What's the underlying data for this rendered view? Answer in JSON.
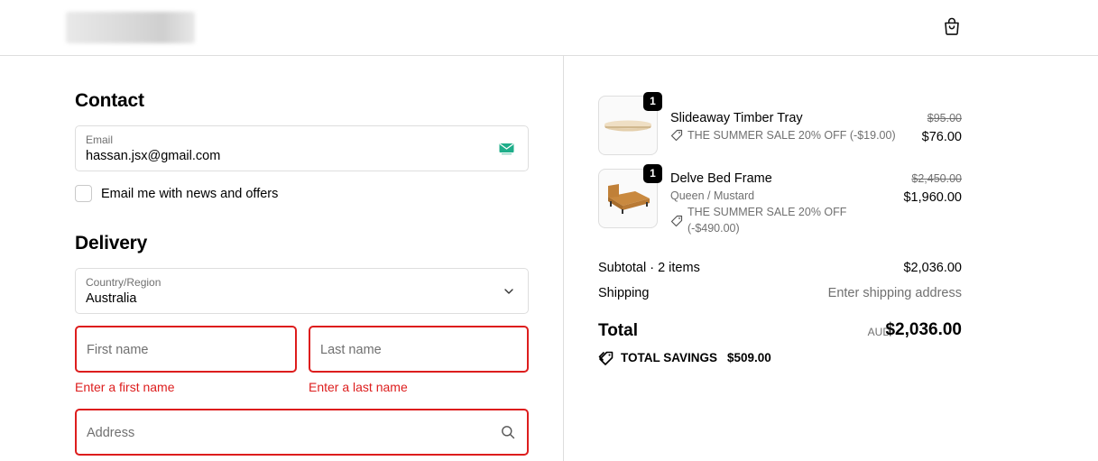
{
  "header": {
    "cart_icon": "shopping-bag-icon"
  },
  "contact": {
    "title": "Contact",
    "email_label": "Email",
    "email_value": "hassan.jsx@gmail.com",
    "newsletter_label": "Email me with news and offers"
  },
  "delivery": {
    "title": "Delivery",
    "country_label": "Country/Region",
    "country_value": "Australia",
    "first_name_placeholder": "First name",
    "last_name_placeholder": "Last name",
    "first_name_error": "Enter a first name",
    "last_name_error": "Enter a last name",
    "address_placeholder": "Address"
  },
  "cart": {
    "items": [
      {
        "quantity": "1",
        "name": "Slideaway Timber Tray",
        "discount": "THE SUMMER SALE 20% OFF (-$19.00)",
        "original_price": "$95.00",
        "price": "$76.00"
      },
      {
        "quantity": "1",
        "name": "Delve Bed Frame",
        "variant": "Queen / Mustard",
        "discount_line1": "THE SUMMER SALE 20% OFF",
        "discount_line2": "(-$490.00)",
        "original_price": "$2,450.00",
        "price": "$1,960.00"
      }
    ]
  },
  "summary": {
    "subtotal_label": "Subtotal · 2 items",
    "subtotal_value": "$2,036.00",
    "shipping_label": "Shipping",
    "shipping_value": "Enter shipping address",
    "total_label": "Total",
    "currency": "AUD",
    "total_value": "$2,036.00",
    "savings_label": "TOTAL SAVINGS",
    "savings_value": "$509.00"
  },
  "colors": {
    "error": "#dd1d1d",
    "border": "#dedede",
    "muted_text": "#707070"
  }
}
